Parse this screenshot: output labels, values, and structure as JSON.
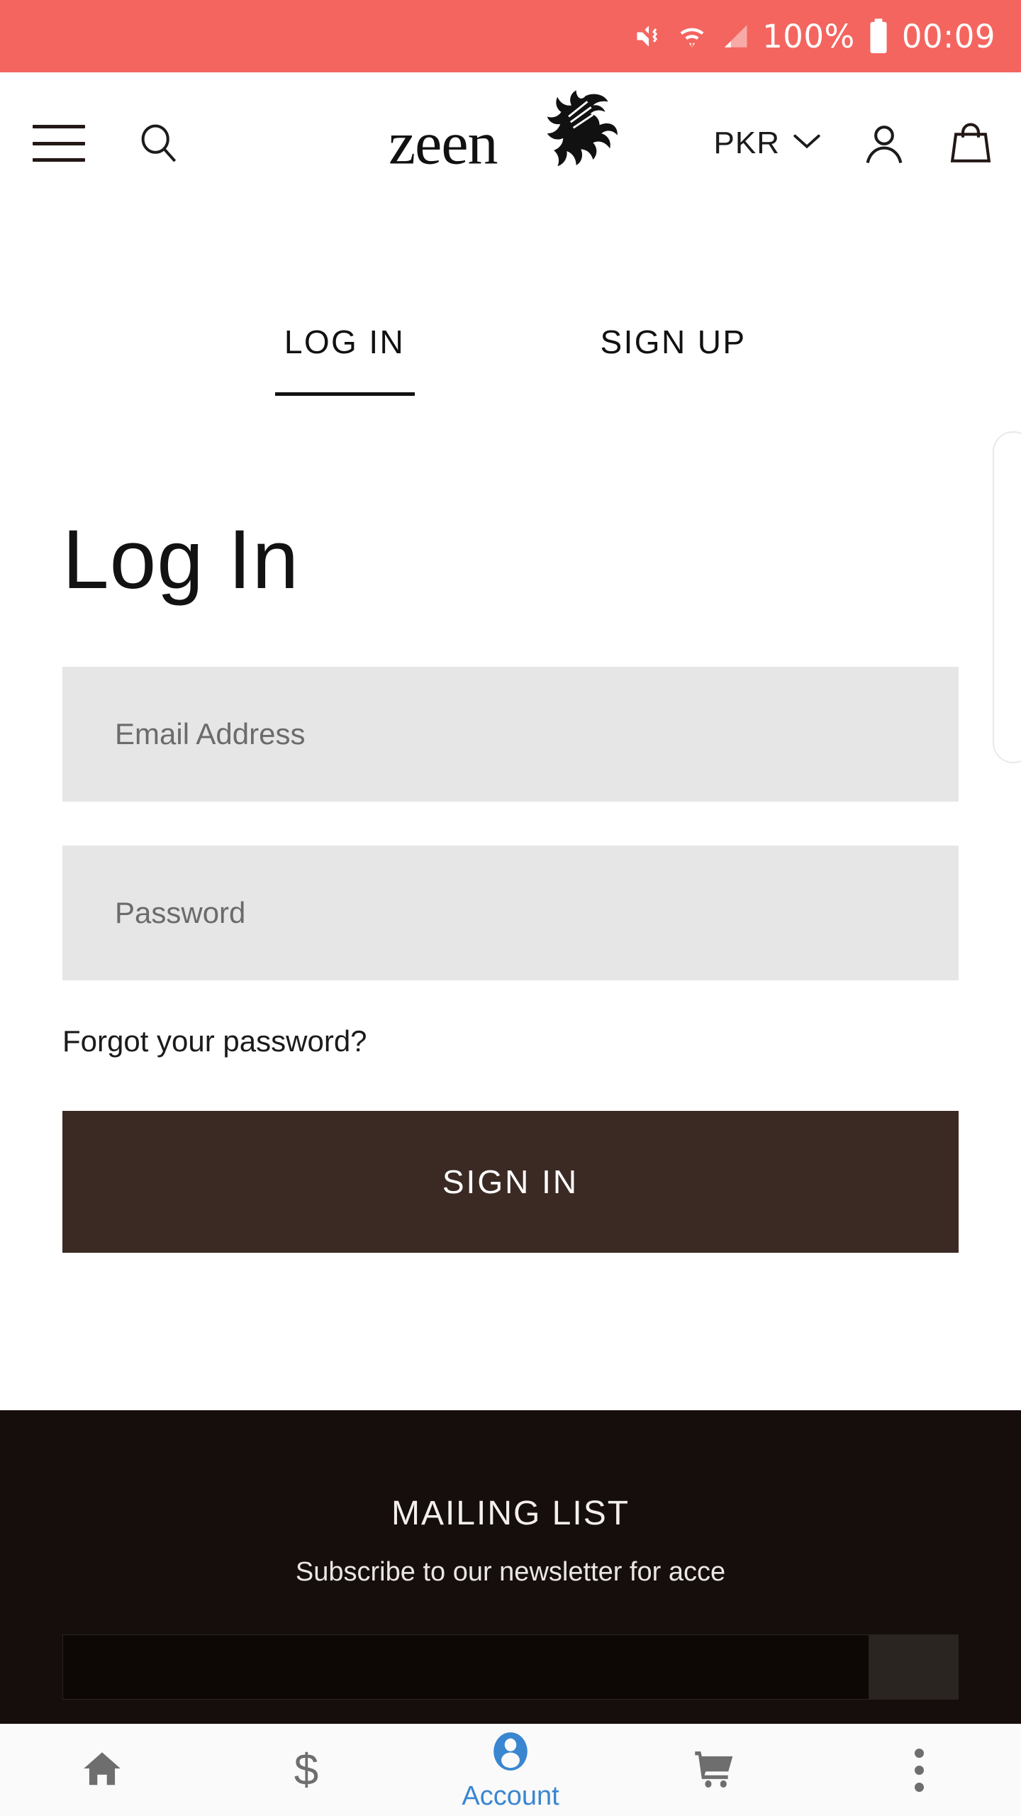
{
  "status_bar": {
    "background": "#F4655F",
    "battery_percent": "100%",
    "time": "00:09",
    "icons": [
      "mute-vibrate-icon",
      "wifi-icon",
      "signal-icon",
      "battery-icon"
    ]
  },
  "header": {
    "menu_icon": "hamburger-menu-icon",
    "search_icon": "search-icon",
    "logo_text": "zeen",
    "logo_flourish": "floral-flourish-icon",
    "currency": "PKR",
    "currency_chevron": "chevron-down-icon",
    "account_icon": "person-icon",
    "bag_icon": "shopping-bag-icon"
  },
  "tabs": [
    {
      "label": "LOG IN",
      "active": true
    },
    {
      "label": "SIGN UP",
      "active": false
    }
  ],
  "main": {
    "title": "Log In",
    "email_placeholder": "Email Address",
    "email_value": "",
    "password_placeholder": "Password",
    "password_value": "",
    "forgot_password": "Forgot your password?",
    "submit_label": "SIGN IN",
    "submit_color": "#3B2A24"
  },
  "footer": {
    "title": "MAILING LIST",
    "subtitle": "Subscribe to our newsletter for acce",
    "newsletter_placeholder": "",
    "background": "#150E0C"
  },
  "bottom_nav": {
    "active_color": "#3A86D0",
    "inactive_color": "#6E6E6E",
    "items": [
      {
        "icon": "home-icon",
        "label": "",
        "active": false
      },
      {
        "icon": "dollar-icon",
        "label": "",
        "active": false
      },
      {
        "icon": "account-icon",
        "label": "Account",
        "active": true
      },
      {
        "icon": "cart-icon",
        "label": "",
        "active": false
      },
      {
        "icon": "more-vertical-icon",
        "label": "",
        "active": false
      }
    ]
  }
}
